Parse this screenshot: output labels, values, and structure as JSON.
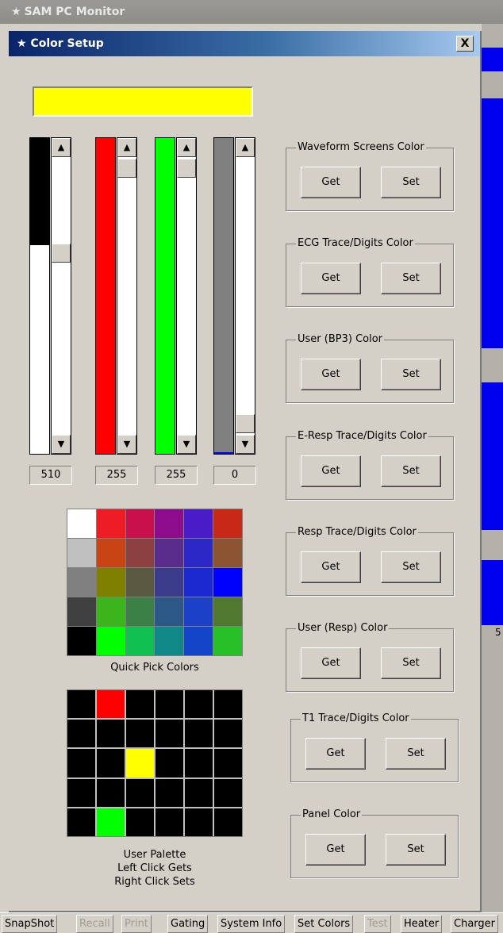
{
  "parent_window": {
    "title": "SAM PC Monitor"
  },
  "dialog": {
    "title": "Color Setup",
    "close_label": "X"
  },
  "preview_color": "#ffff00",
  "channels": [
    {
      "name": "gray",
      "value": "510",
      "color": "#000000"
    },
    {
      "name": "red",
      "value": "255",
      "color": "#ff0000"
    },
    {
      "name": "green",
      "value": "255",
      "color": "#00ff00"
    },
    {
      "name": "blue",
      "value": "0",
      "color": "#808080"
    }
  ],
  "quick_pick": {
    "caption": "Quick Pick Colors",
    "colors": [
      "#ffffff",
      "#ee1c24",
      "#c8104c",
      "#8c0c8c",
      "#4a1cc8",
      "#c82818",
      "#c0c0c0",
      "#c84414",
      "#8c4040",
      "#5a2c8c",
      "#2c28c8",
      "#8c5430",
      "#808080",
      "#808000",
      "#5a5a40",
      "#3c3c8c",
      "#1c28d0",
      "#0000ff",
      "#404040",
      "#3cb41c",
      "#3c8048",
      "#2c5888",
      "#1c40c8",
      "#507830",
      "#000000",
      "#00ff00",
      "#10c050",
      "#108888",
      "#1444c8",
      "#28c028"
    ]
  },
  "user_palette": {
    "caption_lines": [
      "User Palette",
      "Left Click Gets",
      "Right Click Sets"
    ],
    "colors": [
      "#000000",
      "#ff0000",
      "#000000",
      "#000000",
      "#000000",
      "#000000",
      "#000000",
      "#000000",
      "#000000",
      "#000000",
      "#000000",
      "#000000",
      "#000000",
      "#000000",
      "#ffff00",
      "#000000",
      "#000000",
      "#000000",
      "#000000",
      "#000000",
      "#000000",
      "#000000",
      "#000000",
      "#000000",
      "#000000",
      "#00ff00",
      "#000000",
      "#000000",
      "#000000",
      "#000000"
    ]
  },
  "groups": [
    {
      "title": "Waveform Screens Color",
      "get": "Get",
      "set": "Set"
    },
    {
      "title": "ECG Trace/Digits Color",
      "get": "Get",
      "set": "Set"
    },
    {
      "title": "User (BP3) Color",
      "get": "Get",
      "set": "Set"
    },
    {
      "title": "E-Resp Trace/Digits Color",
      "get": "Get",
      "set": "Set"
    },
    {
      "title": "Resp Trace/Digits Color",
      "get": "Get",
      "set": "Set"
    },
    {
      "title": "User (Resp) Color",
      "get": "Get",
      "set": "Set"
    },
    {
      "title": "T1 Trace/Digits Color",
      "get": "Get",
      "set": "Set"
    },
    {
      "title": "Panel Color",
      "get": "Get",
      "set": "Set"
    }
  ],
  "background_text": {
    "side_digit": "5"
  },
  "taskbar": [
    {
      "label": "SnapShot",
      "enabled": true
    },
    {
      "label": "Recall",
      "enabled": false
    },
    {
      "label": "Print",
      "enabled": false
    },
    {
      "label": "Gating",
      "enabled": true
    },
    {
      "label": "System Info",
      "enabled": true
    },
    {
      "label": "Set Colors",
      "enabled": true
    },
    {
      "label": "Test",
      "enabled": false
    },
    {
      "label": "Heater",
      "enabled": true
    },
    {
      "label": "Charger",
      "enabled": true
    }
  ]
}
